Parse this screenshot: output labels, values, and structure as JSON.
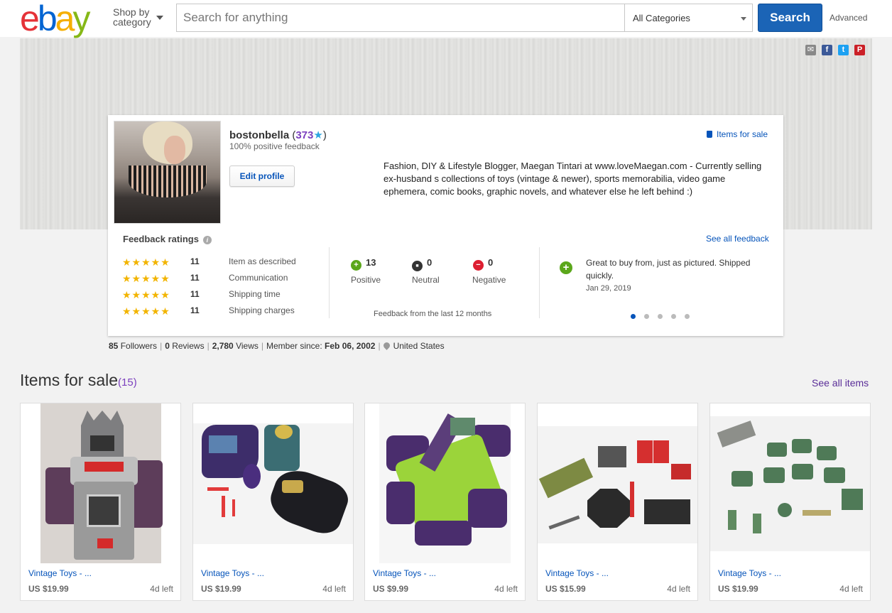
{
  "header": {
    "logo": [
      "e",
      "b",
      "a",
      "y"
    ],
    "logo_colors": [
      "#e53238",
      "#0064d2",
      "#f5af02",
      "#86b817"
    ],
    "shop_by_line1": "Shop by",
    "shop_by_line2": "category",
    "search_placeholder": "Search for anything",
    "category_selected": "All Categories",
    "search_button": "Search",
    "advanced_link": "Advanced"
  },
  "social": [
    {
      "icon": "email-icon",
      "glyph": "✉",
      "color": "#888888"
    },
    {
      "icon": "facebook-icon",
      "glyph": "f",
      "color": "#3b5998"
    },
    {
      "icon": "twitter-icon",
      "glyph": "t",
      "color": "#1da1f2"
    },
    {
      "icon": "pinterest-icon",
      "glyph": "P",
      "color": "#cb2027"
    }
  ],
  "profile": {
    "username": "bostonbella",
    "score_open": " (",
    "score": "373",
    "score_star": "★",
    "score_close": ")",
    "positive_feedback": "100% positive feedback",
    "edit_button": "Edit profile",
    "items_for_sale_link": "Items for sale",
    "bio": "Fashion, DIY & Lifestyle Blogger, Maegan Tintari at www.loveMaegan.com - Currently selling ex-husband s collections of toys (vintage & newer), sports memorabilia, video game ephemera, comic books, graphic novels, and whatever else he left behind :)"
  },
  "feedback": {
    "title": "Feedback ratings",
    "info_glyph": "i",
    "see_all": "See all feedback",
    "ratings": [
      {
        "stars": "★★★★★",
        "count": "11",
        "label": "Item as described"
      },
      {
        "stars": "★★★★★",
        "count": "11",
        "label": "Communication"
      },
      {
        "stars": "★★★★★",
        "count": "11",
        "label": "Shipping time"
      },
      {
        "stars": "★★★★★",
        "count": "11",
        "label": "Shipping charges"
      }
    ],
    "positive": {
      "count": "13",
      "label": "Positive",
      "glyph": "+"
    },
    "neutral": {
      "count": "0",
      "label": "Neutral",
      "glyph": "■"
    },
    "negative": {
      "count": "0",
      "label": "Negative",
      "glyph": "−"
    },
    "period": "Feedback from the last 12 months",
    "comment": "Great to buy from, just as pictured. Shipped quickly.",
    "comment_date": "Jan 29, 2019",
    "comment_glyph": "+",
    "dots": 5
  },
  "stats": {
    "followers": "85",
    "followers_label": "Followers",
    "reviews": "0",
    "reviews_label": "Reviews",
    "views": "2,780",
    "views_label": "Views",
    "member_label": "Member since:",
    "member_since": "Feb 06, 2002",
    "location": "United States",
    "separator": "|"
  },
  "items_section": {
    "title": "Items for sale",
    "count": "(15)",
    "see_all": "See all items",
    "items": [
      {
        "title": "Vintage Toys - ...",
        "price": "US $19.99",
        "time_left": "4d left"
      },
      {
        "title": "Vintage Toys - ...",
        "price": "US $19.99",
        "time_left": "4d left"
      },
      {
        "title": "Vintage Toys - ...",
        "price": "US $9.99",
        "time_left": "4d left"
      },
      {
        "title": "Vintage Toys - ...",
        "price": "US $15.99",
        "time_left": "4d left"
      },
      {
        "title": "Vintage Toys - ...",
        "price": "US $19.99",
        "time_left": "4d left"
      }
    ]
  }
}
